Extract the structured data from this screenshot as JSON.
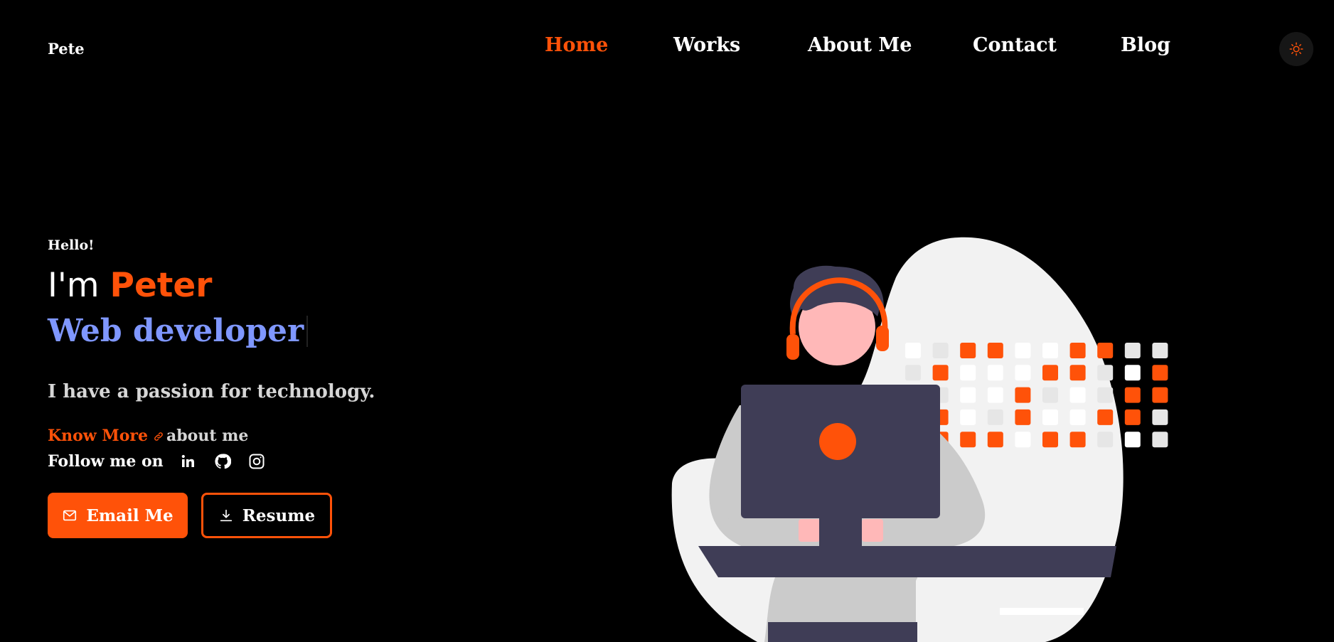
{
  "header": {
    "logo": "Pete",
    "nav": [
      "Home",
      "Works",
      "About Me",
      "Contact",
      "Blog"
    ],
    "active_nav": "Home",
    "theme_toggle_icon": "sun-icon"
  },
  "hero": {
    "greeting": "Hello!",
    "intro_prefix": "I'm",
    "name": "Peter",
    "role": "Web developer",
    "tagline": "I have a passion for technology.",
    "know_more": "Know More",
    "about_me": "about me",
    "follow_label": "Follow me on",
    "socials": [
      "linkedin-icon",
      "github-icon",
      "instagram-icon"
    ],
    "email_button": "Email Me",
    "resume_button": "Resume"
  },
  "colors": {
    "accent": "#ff5209",
    "role_text": "#7f97ff",
    "background": "#000000",
    "illustration_dark": "#3f3d56",
    "illustration_light": "#f2f2f2"
  }
}
